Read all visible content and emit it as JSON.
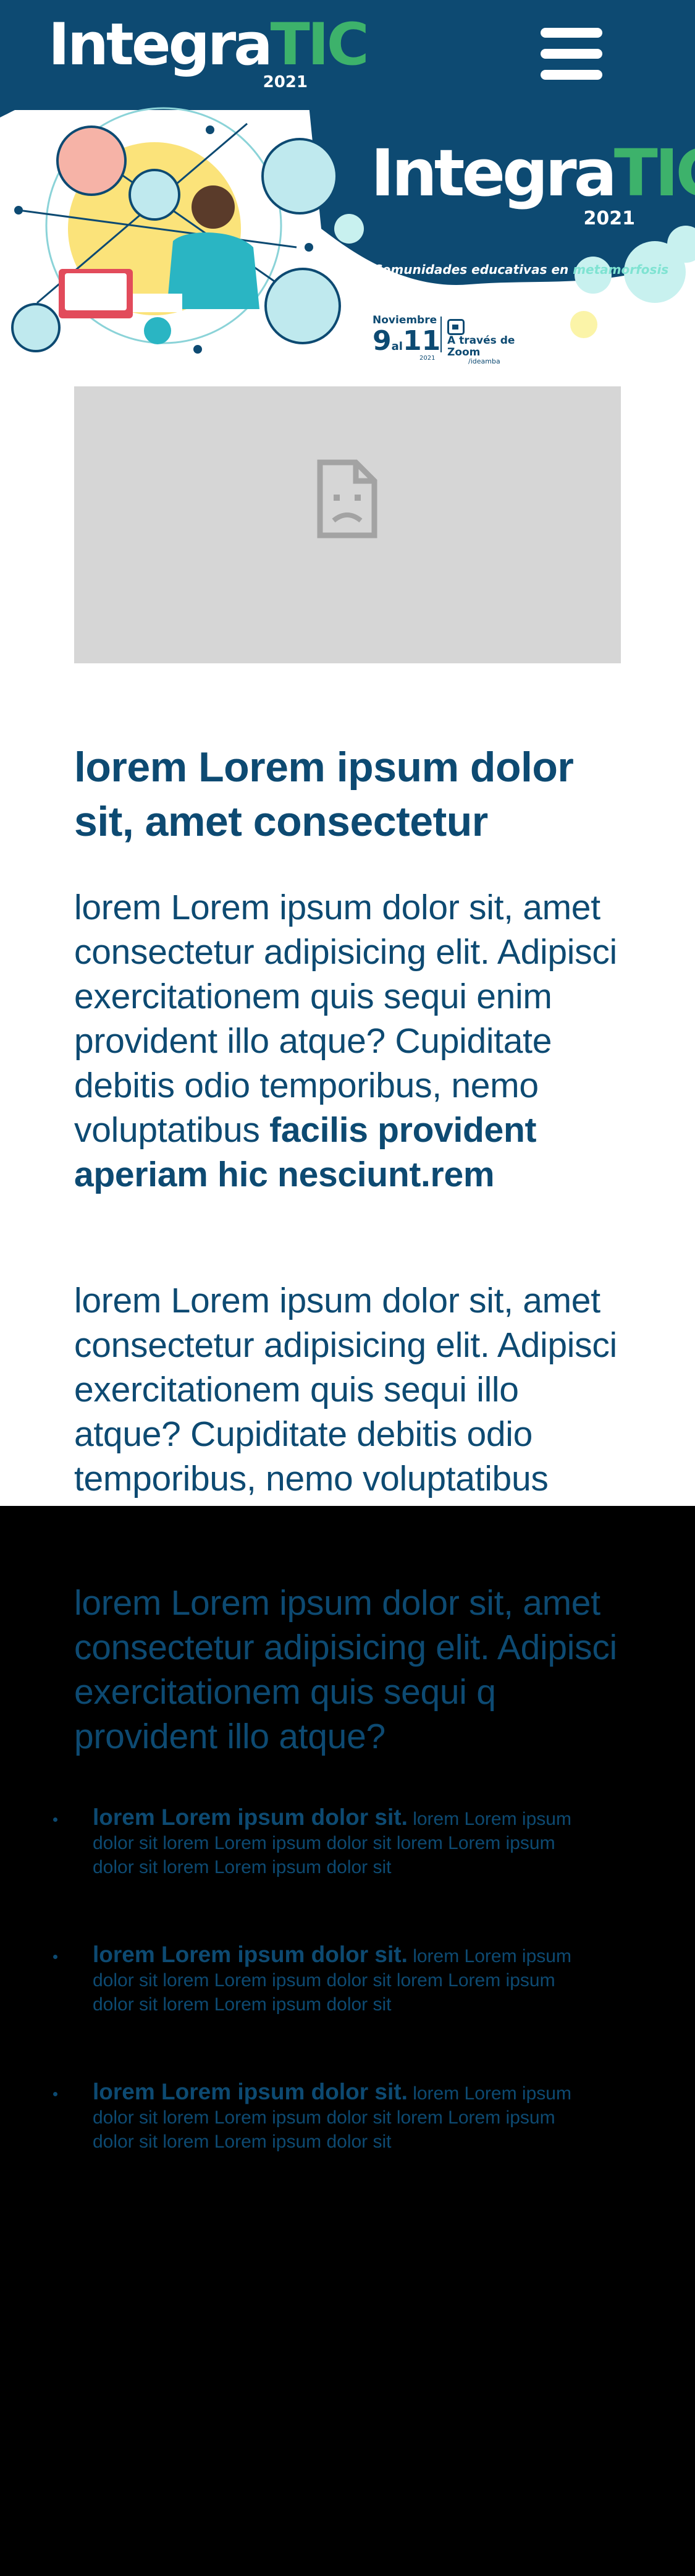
{
  "brand": {
    "name_a": "Integra",
    "name_b": "TIC",
    "year": "2021"
  },
  "hero": {
    "title_a": "Integra",
    "title_b": "TIC",
    "year": "2021",
    "tagline_a": "Comunidades educativas en ",
    "tagline_b": "metamorfosis",
    "event_month": "Noviembre",
    "event_day_start": "9",
    "event_day_connector": "al",
    "event_day_end": "11",
    "event_year": "2021",
    "platform_line1": "A través de",
    "platform_line2": "Zoom",
    "platform_handle": "/ideamba"
  },
  "colors": {
    "brand_blue": "#0d4a72",
    "brand_green": "#3db26b",
    "placeholder_gray": "#d6d6d6"
  },
  "icons": {
    "menu": "hamburger-icon",
    "embed": "broken-document-icon",
    "zoom": "video-camera-icon"
  },
  "content": {
    "heading": "lorem Lorem ipsum dolor sit, amet consectetur",
    "p1_text": "lorem Lorem ipsum dolor sit, amet consectetur adipisicing elit. Adipisci exercitationem quis sequi enim provident illo atque? Cupiditate debitis odio temporibus, nemo voluptatibus ",
    "p1_bold": "facilis provident aperiam hic nesciunt.rem",
    "p2": "lorem Lorem ipsum dolor sit, amet consectetur adipisicing elit. Adipisci exercitationem quis sequi illo atque? Cupiditate debitis odio temporibus, nemo voluptatibus",
    "p3": "lorem Lorem ipsum dolor sit, amet consectetur adipisicing elit. Adipisci exercitationem quis sequi q provident illo atque?",
    "list": [
      {
        "lead": "lorem Lorem ipsum dolor sit.",
        "text": " lorem Lorem ipsum dolor sit lorem Lorem ipsum dolor sit lorem Lorem ipsum dolor sit lorem Lorem ipsum dolor sit"
      },
      {
        "lead": "lorem Lorem ipsum dolor sit.",
        "text": " lorem Lorem ipsum dolor sit lorem Lorem ipsum dolor sit lorem Lorem ipsum dolor sit lorem Lorem ipsum dolor sit"
      },
      {
        "lead": "lorem Lorem ipsum dolor sit.",
        "text": " lorem Lorem ipsum dolor sit lorem Lorem ipsum dolor sit lorem Lorem ipsum dolor sit lorem Lorem ipsum dolor sit"
      }
    ]
  }
}
